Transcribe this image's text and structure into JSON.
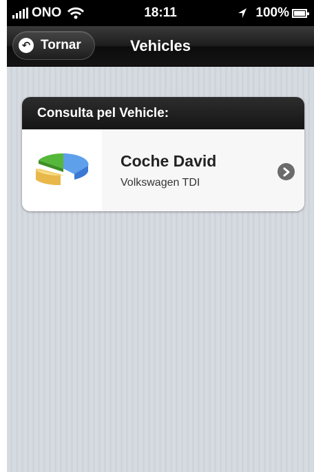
{
  "status_bar": {
    "carrier": "ONO",
    "time": "18:11",
    "battery": "100%"
  },
  "nav": {
    "back_label": "Tornar",
    "title": "Vehicles"
  },
  "section": {
    "header": "Consulta pel Vehicle:",
    "items": [
      {
        "title": "Coche David",
        "subtitle": "Volkswagen TDI",
        "icon": "pie-chart-icon"
      }
    ]
  },
  "colors": {
    "nav_background": "#1c1c1c",
    "content_background": "#d3d7de",
    "chevron": "#6b6b6b"
  }
}
